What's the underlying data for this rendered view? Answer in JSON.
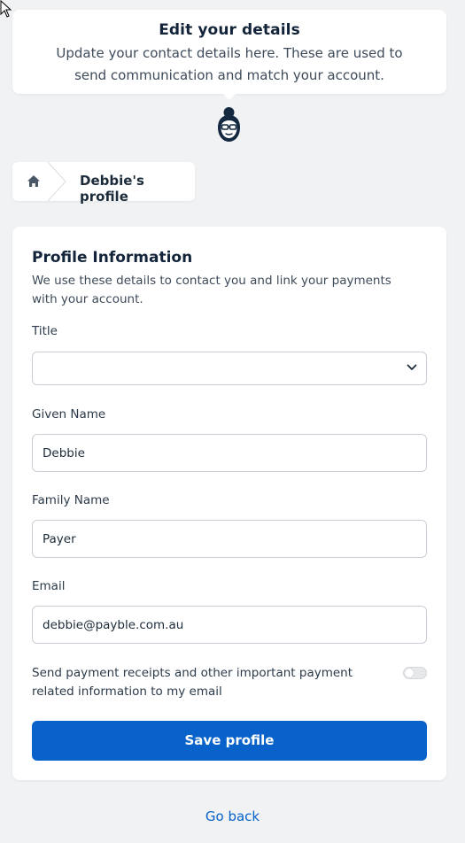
{
  "header": {
    "title": "Edit your details",
    "subtitle": "Update your contact details here. These are used to send communication and match your account."
  },
  "breadcrumb": {
    "home_icon": "home-icon",
    "current": "Debbie's profile"
  },
  "profile": {
    "title": "Profile Information",
    "description": "We use these details to contact you and link your payments with your account.",
    "fields": {
      "title_label": "Title",
      "title_value": "",
      "given_name_label": "Given Name",
      "given_name_value": "Debbie",
      "family_name_label": "Family Name",
      "family_name_value": "Payer",
      "email_label": "Email",
      "email_value": "debbie@payble.com.au"
    },
    "toggle_label": "Send payment receipts and other important payment related information to my email",
    "toggle_on": false,
    "save_label": "Save profile"
  },
  "footer": {
    "go_back": "Go back"
  },
  "colors": {
    "accent": "#0962c9",
    "background": "#f1f2f4",
    "text": "#1c2b3a"
  }
}
